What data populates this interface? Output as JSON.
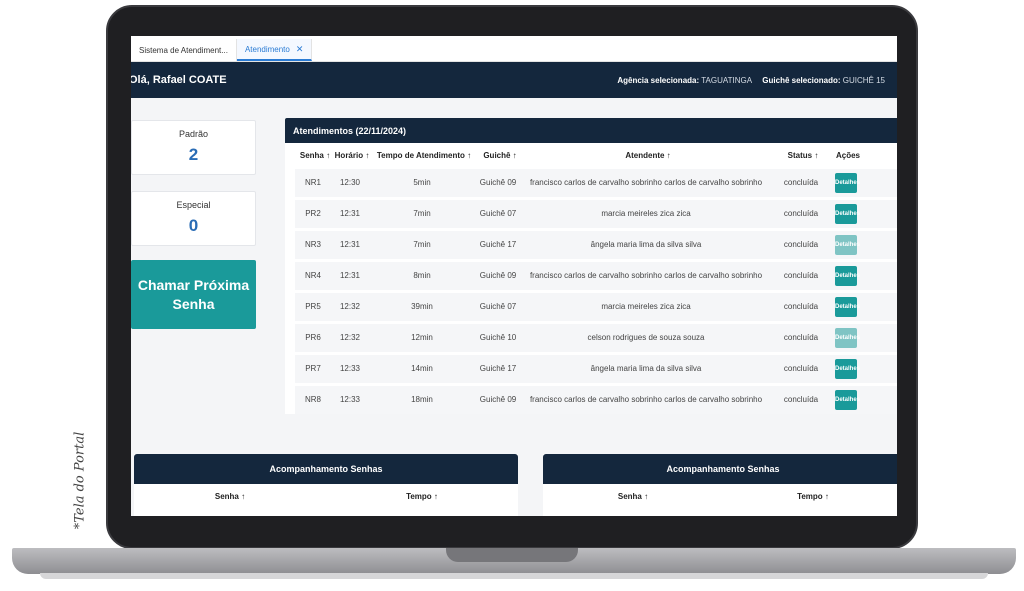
{
  "caption": "*Tela do Portal",
  "tabs": [
    {
      "label": "Sistema de Atendiment..."
    },
    {
      "label": "Atendimento",
      "close": "✕"
    }
  ],
  "header": {
    "greeting": "Olá, Rafael COATE",
    "agency_label": "Agência selecionada:",
    "agency_value": "TAGUATINGA",
    "counter_label": "Guichê selecionado:",
    "counter_value": "GUICHÊ 15"
  },
  "queues": [
    {
      "label": "Padrão",
      "count": "2"
    },
    {
      "label": "Especial",
      "count": "0"
    }
  ],
  "call_button": "Chamar Próxima Senha",
  "table": {
    "title": "Atendimentos (22/11/2024)",
    "columns": [
      "Senha ↑",
      "Horário ↑",
      "Tempo de Atendimento ↑",
      "Guichê ↑",
      "Atendente ↑",
      "Status ↑",
      "Ações"
    ],
    "action_label": "Detalhes",
    "rows": [
      {
        "senha": "NR1",
        "horario": "12:30",
        "tempo": "5min",
        "guiche": "Guichê 09",
        "atendente": "francisco carlos de carvalho sobrinho carlos de carvalho sobrinho",
        "status": "concluída"
      },
      {
        "senha": "PR2",
        "horario": "12:31",
        "tempo": "7min",
        "guiche": "Guichê 07",
        "atendente": "marcia meireles zica zica",
        "status": "concluída"
      },
      {
        "senha": "NR3",
        "horario": "12:31",
        "tempo": "7min",
        "guiche": "Guichê 17",
        "atendente": "ângela maria lima da silva silva",
        "status": "concluída"
      },
      {
        "senha": "NR4",
        "horario": "12:31",
        "tempo": "8min",
        "guiche": "Guichê 09",
        "atendente": "francisco carlos de carvalho sobrinho carlos de carvalho sobrinho",
        "status": "concluída"
      },
      {
        "senha": "PR5",
        "horario": "12:32",
        "tempo": "39min",
        "guiche": "Guichê 07",
        "atendente": "marcia meireles zica zica",
        "status": "concluída"
      },
      {
        "senha": "PR6",
        "horario": "12:32",
        "tempo": "12min",
        "guiche": "Guichê 10",
        "atendente": "celson rodrigues de souza souza",
        "status": "concluída"
      },
      {
        "senha": "PR7",
        "horario": "12:33",
        "tempo": "14min",
        "guiche": "Guichê 17",
        "atendente": "ângela maria lima da silva silva",
        "status": "concluída"
      },
      {
        "senha": "NR8",
        "horario": "12:33",
        "tempo": "18min",
        "guiche": "Guichê 09",
        "atendente": "francisco carlos de carvalho sobrinho carlos de carvalho sobrinho",
        "status": "concluída"
      }
    ]
  },
  "tracking": [
    {
      "title": "Acompanhamento Senhas",
      "col_senha": "Senha ↑",
      "col_tempo": "Tempo ↑"
    },
    {
      "title": "Acompanhamento Senhas",
      "col_senha": "Senha ↑",
      "col_tempo": "Tempo ↑"
    }
  ],
  "colors": {
    "navy": "#14273d",
    "teal": "#1a9a9a",
    "accent_blue": "#2a6cb5"
  }
}
